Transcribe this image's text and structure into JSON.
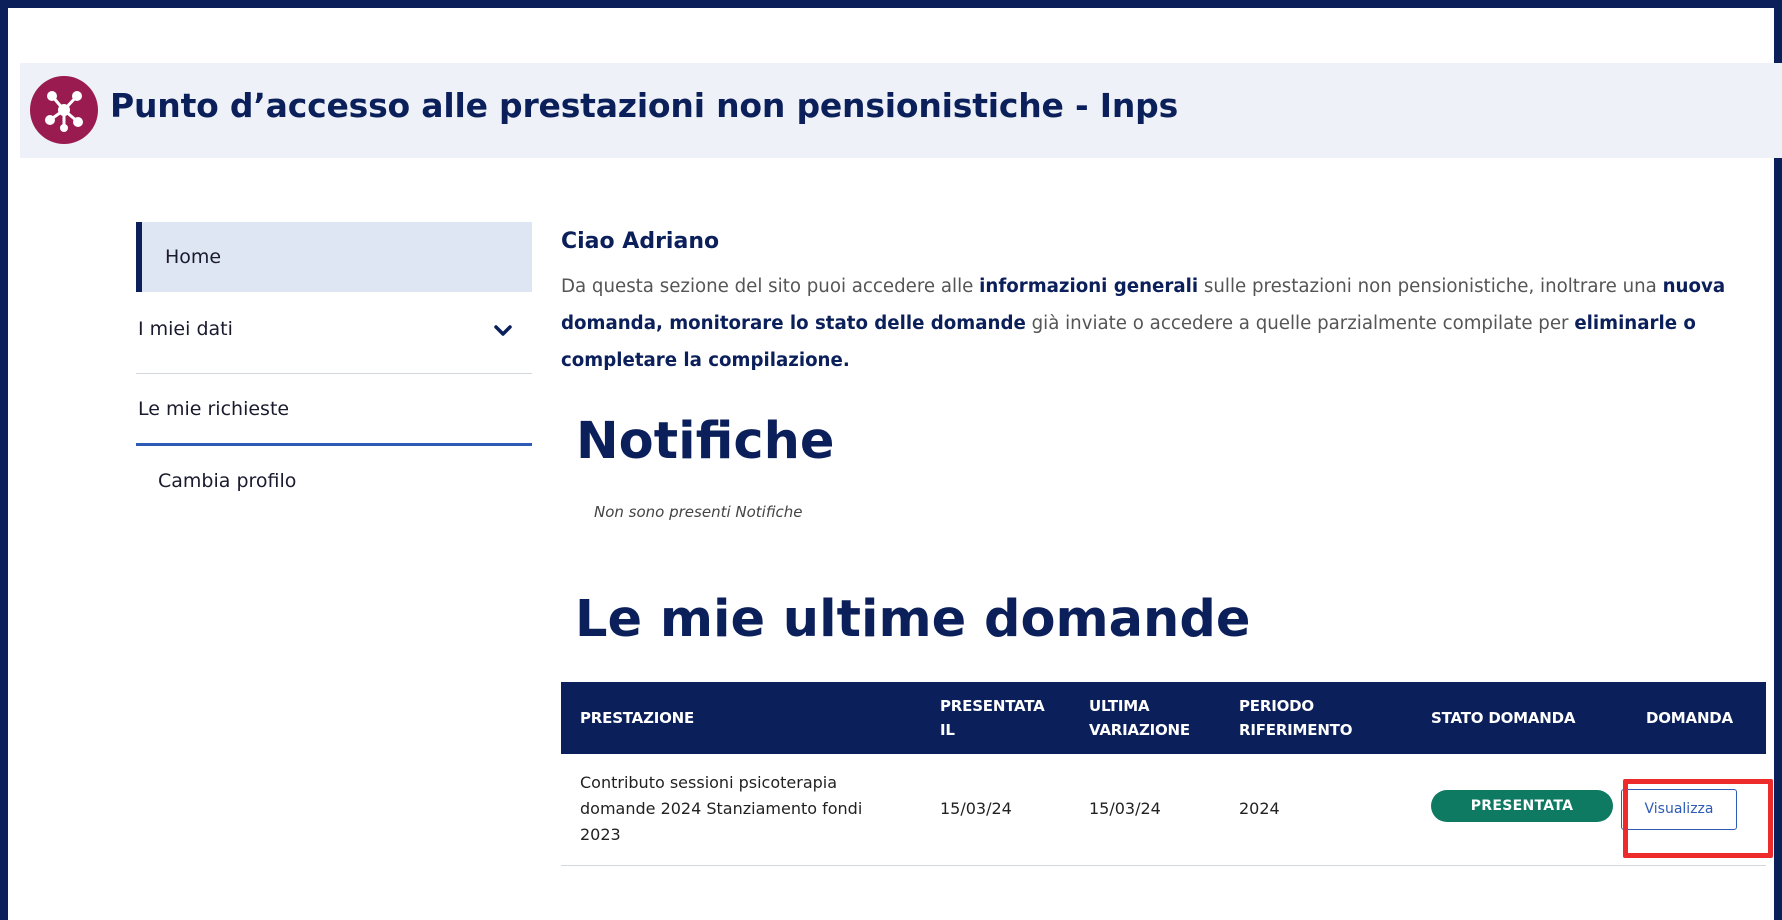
{
  "header": {
    "title": "Punto d’accesso alle prestazioni non pensionistiche - Inps",
    "logo_icon": "network-hub-icon",
    "logo_color": "#9a1b4f"
  },
  "sidebar": {
    "items": [
      {
        "label": "Home",
        "active": true
      },
      {
        "label": "I miei dati",
        "icon": "chevron-down-icon"
      },
      {
        "label": "Le mie richieste"
      },
      {
        "label": "Cambia profilo"
      }
    ]
  },
  "main": {
    "greeting": "Ciao Adriano",
    "intro": {
      "p1": "Da questa sezione del sito puoi accedere alle ",
      "b1": "informazioni generali",
      "p2": " sulle prestazioni non pensionistiche, inoltrare una ",
      "b2": "nuova domanda, monitorare lo stato delle domande",
      "p3": " già inviate o accedere a quelle parzialmente compilate per ",
      "b3": "eliminarle o completare la compilazione."
    },
    "notifications_title": "Notifiche",
    "notifications_empty": "Non sono presenti Notifiche",
    "requests_title": "Le mie ultime domande"
  },
  "table": {
    "headers": {
      "prestazione": "PRESTAZIONE",
      "presentata_il": "PRESENTATA IL",
      "ultima_variazione": "ULTIMA VARIAZIONE",
      "periodo_riferimento": "PERIODO RIFERIMENTO",
      "stato_domanda": "STATO DOMANDA",
      "domanda": "DOMANDA"
    },
    "rows": [
      {
        "prestazione": "Contributo sessioni psicoterapia domande 2024 Stanziamento fondi 2023",
        "presentata_il": "15/03/24",
        "ultima_variazione": "15/03/24",
        "periodo_riferimento": "2024",
        "stato_domanda": "PRESENTATA",
        "azione": "Visualizza"
      }
    ]
  },
  "colors": {
    "primary": "#0b1f5b",
    "status_presentata": "#0e7a62",
    "highlight": "#ee2b2b",
    "link": "#2d5bb5"
  }
}
